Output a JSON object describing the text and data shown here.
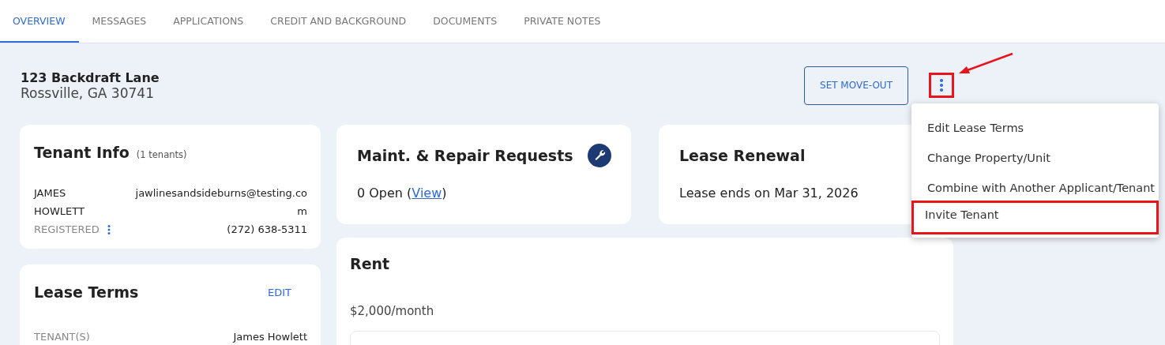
{
  "tabs": [
    {
      "label": "OVERVIEW",
      "selected": true
    },
    {
      "label": "MESSAGES",
      "selected": false
    },
    {
      "label": "APPLICATIONS",
      "selected": false
    },
    {
      "label": "CREDIT AND BACKGROUND",
      "selected": false
    },
    {
      "label": "DOCUMENTS",
      "selected": false
    },
    {
      "label": "PRIVATE NOTES",
      "selected": false
    }
  ],
  "address": {
    "street": "123 Backdraft Lane",
    "city": "Rossville, GA 30741"
  },
  "set_move_out_button": "SET MOVE-OUT",
  "more_button": {
    "highlighted": true
  },
  "menu": [
    {
      "label": "Edit Lease Terms",
      "highlighted": false
    },
    {
      "label": "Change Property/Unit",
      "highlighted": false
    },
    {
      "label": "Combine with Another Applicant/Tenant",
      "highlighted": false
    },
    {
      "label": "Invite Tenant",
      "highlighted": true
    }
  ],
  "tenant_info": {
    "title": "Tenant Info",
    "count": "(1 tenants)",
    "first_name": "JAMES",
    "last_name": "HOWLETT",
    "email": "jawlinesandsideburns@testing.com",
    "status": "REGISTERED",
    "phone": "(272) 638-5311"
  },
  "lease_terms": {
    "title": "Lease Terms",
    "edit": "EDIT",
    "rows": [
      {
        "label": "TENANT(S)",
        "value": "James Howlett"
      }
    ]
  },
  "maintenance": {
    "title": "Maint. & Repair Requests",
    "open": "0 Open (",
    "link": "View",
    "close": ")"
  },
  "lease_renewal": {
    "title": "Lease Renewal",
    "text": "Lease ends on Mar 31, 2026"
  },
  "rent": {
    "title": "Rent",
    "amount": "$2,000/month"
  }
}
